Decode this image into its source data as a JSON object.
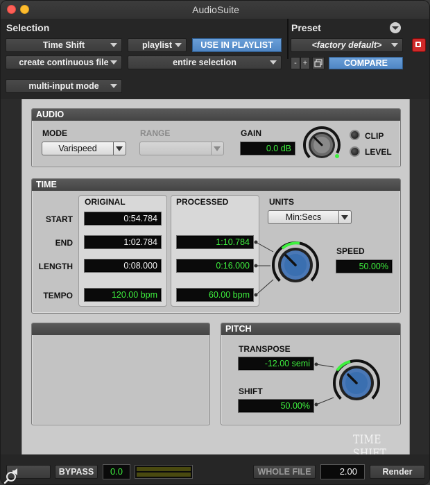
{
  "window": {
    "title": "AudioSuite"
  },
  "selection": {
    "label": "Selection",
    "plugin": "Time Shift",
    "playlist": "playlist",
    "use_in_playlist": "USE IN PLAYLIST",
    "file_mode": "create continuous file",
    "selection_mode": "entire selection",
    "input_mode": "multi-input mode"
  },
  "preset": {
    "label": "Preset",
    "name": "<factory default>",
    "minus": "-",
    "plus": "+",
    "compare": "COMPARE"
  },
  "audio": {
    "title": "AUDIO",
    "mode_label": "MODE",
    "mode_value": "Varispeed",
    "range_label": "RANGE",
    "range_value": "",
    "gain_label": "GAIN",
    "gain_value": "0.0 dB",
    "clip_label": "CLIP",
    "level_label": "LEVEL"
  },
  "time": {
    "title": "TIME",
    "original_label": "ORIGINAL",
    "processed_label": "PROCESSED",
    "units_label": "UNITS",
    "units_value": "Min:Secs",
    "start_label": "START",
    "end_label": "END",
    "length_label": "LENGTH",
    "tempo_label": "TEMPO",
    "speed_label": "SPEED",
    "original_start": "0:54.784",
    "original_end": "1:02.784",
    "original_length": "0:08.000",
    "original_tempo": "120.00 bpm",
    "processed_end": "1:10.784",
    "processed_length": "0:16.000",
    "processed_tempo": "60.00 bpm",
    "speed_value": "50.00%"
  },
  "pitch": {
    "title": "PITCH",
    "transpose_label": "TRANSPOSE",
    "transpose_value": "-12.00 semi",
    "shift_label": "SHIFT",
    "shift_value": "50.00%"
  },
  "brand": "TIME SHIFT",
  "footer": {
    "bypass": "BYPASS",
    "level": "0.0",
    "whole_file": "WHOLE FILE",
    "handle": "2.00",
    "render": "Render"
  },
  "colors": {
    "accent_blue": "#4f86c4",
    "display_green": "#3ef03e",
    "display_white": "#f4f4f4",
    "knob_blue": "#3a6fb0",
    "record_red": "#d02a2a"
  }
}
